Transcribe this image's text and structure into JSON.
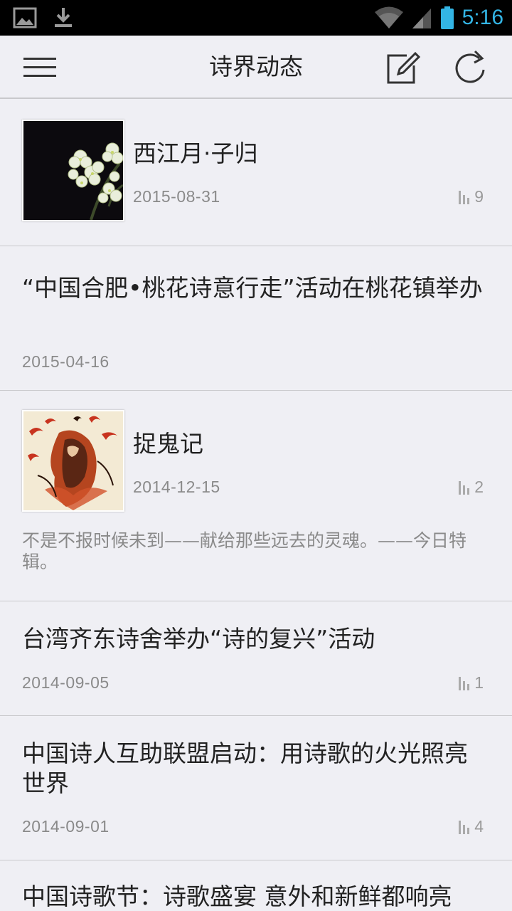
{
  "status_bar": {
    "time": "5:16",
    "icons": [
      "image-icon",
      "download-icon",
      "wifi-icon",
      "signal-icon",
      "battery-icon"
    ],
    "clock_color": "#33b5e5"
  },
  "action_bar": {
    "title": "诗界动态",
    "icons": [
      "menu-icon",
      "compose-icon",
      "refresh-icon"
    ]
  },
  "articles": [
    {
      "title": "西江月·子归",
      "date": "2015-08-31",
      "views": "9",
      "has_thumbnail": true,
      "thumbnail": "white-flowers-photo"
    },
    {
      "title": "“中国合肥•桃花诗意行走”活动在桃花镇举办",
      "date": "2015-04-16",
      "has_thumbnail": false
    },
    {
      "title": "捉鬼记",
      "date": "2014-12-15",
      "views": "2",
      "has_thumbnail": true,
      "thumbnail": "zhong-kui-painting",
      "summary": "不是不报时候未到——献给那些远去的灵魂。——今日特辑。"
    },
    {
      "title": "台湾齐东诗舍举办“诗的复兴”活动",
      "date": "2014-09-05",
      "views": "1",
      "has_thumbnail": false
    },
    {
      "title": "中国诗人互助联盟启动：用诗歌的火光照亮世界",
      "date": "2014-09-01",
      "views": "4",
      "has_thumbnail": false
    },
    {
      "title": "中国诗歌节：诗歌盛宴 意外和新鲜都响亮",
      "has_thumbnail": false
    }
  ]
}
